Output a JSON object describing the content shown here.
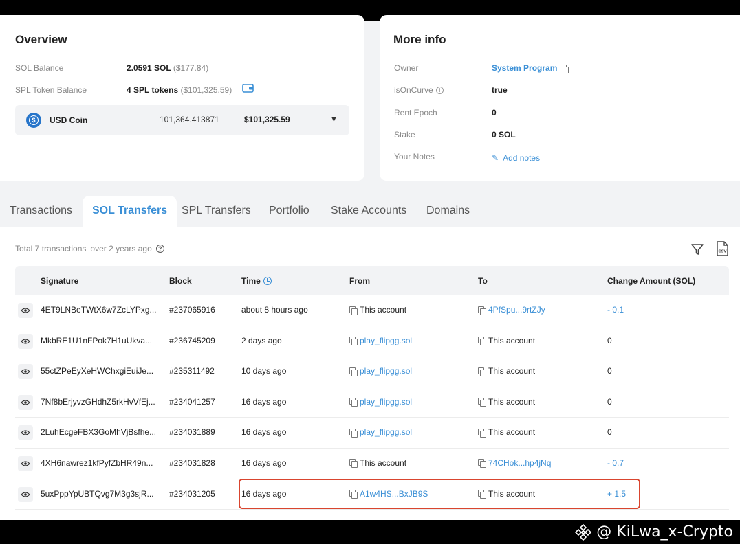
{
  "overview": {
    "title": "Overview",
    "sol_balance_label": "SOL Balance",
    "sol_balance_value": "2.0591 SOL",
    "sol_balance_usd": "($177.84)",
    "spl_label": "SPL Token Balance",
    "spl_value": "4 SPL tokens",
    "spl_usd": "($101,325.59)",
    "token": {
      "name": "USD Coin",
      "amount": "101,364.413871",
      "usd": "$101,325.59"
    }
  },
  "more_info": {
    "title": "More info",
    "rows": [
      {
        "label": "Owner",
        "value": "System Program"
      },
      {
        "label": "isOnCurve",
        "value": "true"
      },
      {
        "label": "Rent Epoch",
        "value": "0"
      },
      {
        "label": "Stake",
        "value": "0 SOL"
      },
      {
        "label": "Your Notes",
        "value": "Add notes"
      }
    ]
  },
  "tabs": [
    "Transactions",
    "SOL Transfers",
    "SPL Transfers",
    "Portfolio",
    "Stake Accounts",
    "Domains"
  ],
  "active_tab": "SOL Transfers",
  "summary": {
    "total": "Total 7 transactions",
    "range": "over 2 years ago"
  },
  "table": {
    "headers": [
      "Signature",
      "Block",
      "Time",
      "From",
      "To",
      "Change Amount (SOL)"
    ],
    "rows": [
      {
        "signature": "4ET9LNBeTWtX6w7ZcLYPxg...",
        "block": "#237065916",
        "time": "about 8 hours ago",
        "from": "This account",
        "to": "4PfSpu...9rtZJy",
        "change": "- 0.1"
      },
      {
        "signature": "MkbRE1U1nFPok7H1uUkva...",
        "block": "#236745209",
        "time": "2 days ago",
        "from": "play_flipgg.sol",
        "to": "This account",
        "change": "0"
      },
      {
        "signature": "55ctZPeEyXeHWChxgiEuiJe...",
        "block": "#235311492",
        "time": "10 days ago",
        "from": "play_flipgg.sol",
        "to": "This account",
        "change": "0"
      },
      {
        "signature": "7Nf8bErjyvzGHdhZ5rkHvVfEj...",
        "block": "#234041257",
        "time": "16 days ago",
        "from": "play_flipgg.sol",
        "to": "This account",
        "change": "0"
      },
      {
        "signature": "2LuhEcgeFBX3GoMhVjBsfhe...",
        "block": "#234031889",
        "time": "16 days ago",
        "from": "play_flipgg.sol",
        "to": "This account",
        "change": "0"
      },
      {
        "signature": "4XH6nawrez1kfPyfZbHR49n...",
        "block": "#234031828",
        "time": "16 days ago",
        "from": "This account",
        "to": "74CHok...hp4jNq",
        "change": "- 0.7"
      },
      {
        "signature": "5uxPppYpUBTQvg7M3g3sjR...",
        "block": "#234031205",
        "time": "16 days ago",
        "from": "A1w4HS...BxJB9S",
        "to": "This account",
        "change": "+ 1.5"
      }
    ]
  },
  "watermark": "@ KiLwa_x-Crypto",
  "colors": {
    "link": "#3a8fd6",
    "highlight": "#d9452f",
    "usdc": "#2775ca"
  }
}
